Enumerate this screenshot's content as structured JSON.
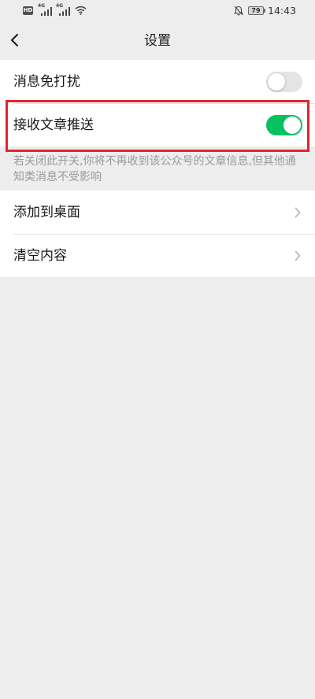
{
  "status_bar": {
    "hd_label": "HD",
    "network_1": "4G",
    "network_2": "4G",
    "battery_level": "79",
    "time": "14:43",
    "icons": [
      "hd-icon",
      "signal-icon",
      "wifi-icon",
      "bell-off-icon",
      "battery-icon"
    ]
  },
  "header": {
    "title": "设置",
    "back_icon": "chevron-left-icon"
  },
  "settings": {
    "mute": {
      "label": "消息免打扰",
      "enabled": false
    },
    "article_push": {
      "label": "接收文章推送",
      "enabled": true,
      "highlighted": true
    },
    "article_push_note": "若关闭此开关,你将不再收到该公众号的文章信息,但其他通知类消息不受影响"
  },
  "actions": [
    {
      "label": "添加到桌面",
      "icon": "chevron-right-icon"
    },
    {
      "label": "清空内容",
      "icon": "chevron-right-icon"
    }
  ],
  "colors": {
    "background": "#ededed",
    "card": "#ffffff",
    "text": "#191919",
    "secondary_text": "#9a9a9a",
    "toggle_on": "#07c160",
    "toggle_off": "#e4e4e4",
    "highlight_border": "#e0262c",
    "divider": "#e5e5e5",
    "arrow": "#b2b2b2"
  }
}
